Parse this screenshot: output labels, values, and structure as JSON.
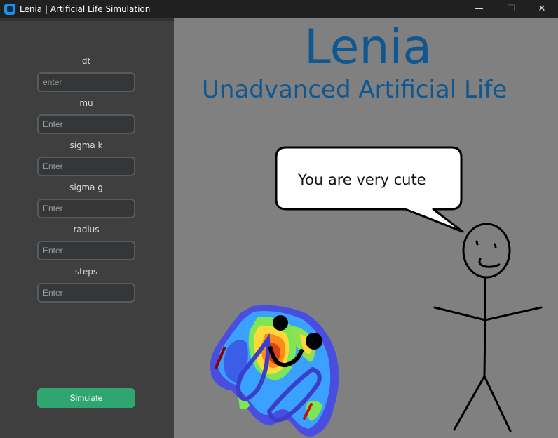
{
  "window": {
    "title": "Lenia | Artificial Life Simulation",
    "controls": {
      "minimize": "—",
      "maximize": "☐",
      "close": "✕"
    }
  },
  "sidebar": {
    "fields": [
      {
        "label": "dt",
        "placeholder": "enter",
        "value": ""
      },
      {
        "label": "mu",
        "placeholder": "Enter",
        "value": ""
      },
      {
        "label": "sigma k",
        "placeholder": "Enter",
        "value": ""
      },
      {
        "label": "sigma g",
        "placeholder": "Enter",
        "value": ""
      },
      {
        "label": "radius",
        "placeholder": "Enter",
        "value": ""
      },
      {
        "label": "steps",
        "placeholder": "Enter",
        "value": ""
      }
    ],
    "simulate_label": "Simulate"
  },
  "main": {
    "title": "Lenia",
    "subtitle": "Unadvanced Artificial Life",
    "speech": "You are very cute"
  },
  "colors": {
    "title_bar": "#202020",
    "sidebar_bg": "#3f3f3f",
    "main_bg": "#808080",
    "title_text": "#0e5790",
    "input_bg": "#343638",
    "input_border": "#565b5e",
    "accent_green": "#2fa572"
  }
}
